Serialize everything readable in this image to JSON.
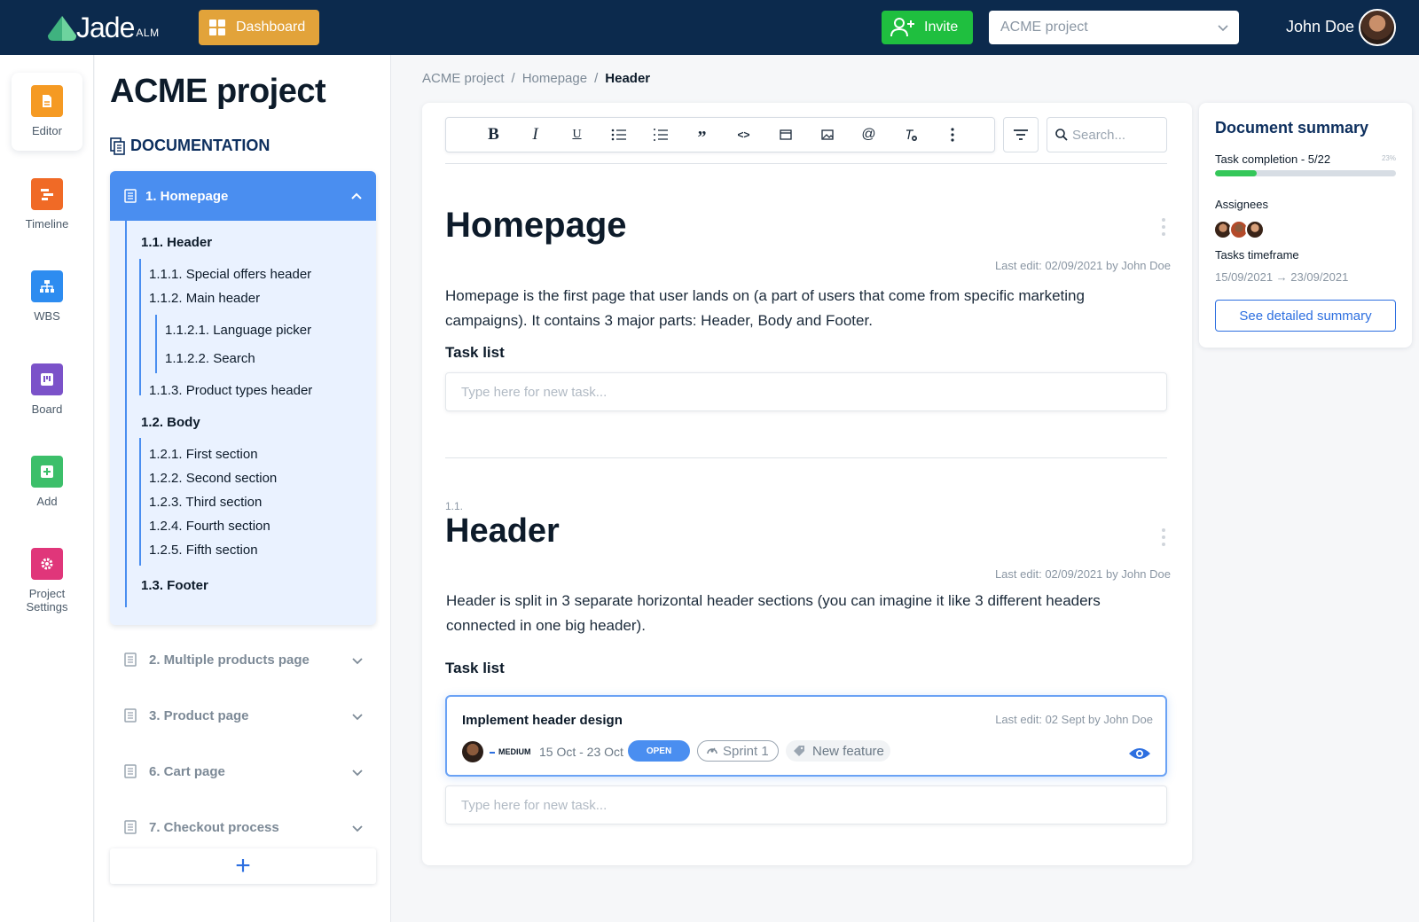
{
  "topbar": {
    "logo_main": "Jade",
    "logo_sub": "ALM",
    "dashboard_label": "Dashboard",
    "invite_label": "Invite",
    "project_select_value": "ACME project",
    "user_name": "John Doe",
    "brand_color": "#0c2a4d"
  },
  "rail": {
    "items": [
      {
        "label": "Editor",
        "icon": "file-icon",
        "color": "#f59a23"
      },
      {
        "label": "Timeline",
        "icon": "timeline-icon",
        "color": "#f06a26"
      },
      {
        "label": "WBS",
        "icon": "hierarchy-icon",
        "color": "#2d8cf0"
      },
      {
        "label": "Board",
        "icon": "board-icon",
        "color": "#7b52c9"
      },
      {
        "label": "Add",
        "icon": "plus-icon",
        "color": "#3cbf6a"
      },
      {
        "label": "Project Settings",
        "icon": "gear-icon",
        "color": "#e0367a"
      }
    ]
  },
  "tree": {
    "project_title": "ACME project",
    "section_label": "DOCUMENTATION",
    "open_item": "1. Homepage",
    "children": [
      "1.1. Header",
      "1.1.1. Special offers header",
      "1.1.2. Main header",
      "1.1.2.1. Language picker",
      "1.1.2.2. Search",
      "1.1.3. Product types header",
      "1.2. Body",
      "1.2.1. First section",
      "1.2.2. Second section",
      "1.2.3. Third section",
      "1.2.4. Fourth section",
      "1.2.5. Fifth section",
      "1.3. Footer"
    ],
    "collapsed": [
      "2. Multiple products page",
      "3. Product page",
      "6. Cart page",
      "7. Checkout process"
    ],
    "add_label": "+"
  },
  "breadcrumb": {
    "items": [
      "ACME project",
      "Homepage",
      "Header"
    ],
    "separator": "/"
  },
  "editor": {
    "search_placeholder": "Search...",
    "toolbar": {
      "bold": "B",
      "italic": "I",
      "underline": "U",
      "quote": "”",
      "code": "<>",
      "mention": "@"
    },
    "section1": {
      "title": "Homepage",
      "last_edit": "Last edit: 02/09/2021 by John Doe",
      "body": "Homepage is the first page that user lands on (a part of users that come from specific marketing campaigns). It contains 3 major parts: Header, Body and Footer.",
      "task_list_label": "Task list",
      "task_placeholder": "Type here for new task..."
    },
    "section2": {
      "number": "1.1.",
      "title": "Header",
      "last_edit": "Last edit: 02/09/2021 by John Doe",
      "body": "Header is split in 3 separate horizontal header sections (you can imagine it like 3 different headers connected in one big header).",
      "task_list_label": "Task list",
      "task_placeholder": "Type here for new task...",
      "task": {
        "title": "Implement header design",
        "last_edit": "Last edit: 02 Sept by John Doe",
        "priority": "MEDIUM",
        "dates": "15 Oct - 23 Oct",
        "status": "OPEN",
        "sprint": "Sprint 1",
        "tag": "New feature"
      }
    }
  },
  "summary": {
    "title": "Document summary",
    "completion_label": "Task completion - 5/22",
    "completion_pct_label": "23%",
    "completion_fraction": 0.23,
    "assignees_label": "Assignees",
    "timeframe_label": "Tasks timeframe",
    "timeframe_value": "15/09/2021 → 23/09/2021",
    "detail_button": "See detailed summary"
  }
}
